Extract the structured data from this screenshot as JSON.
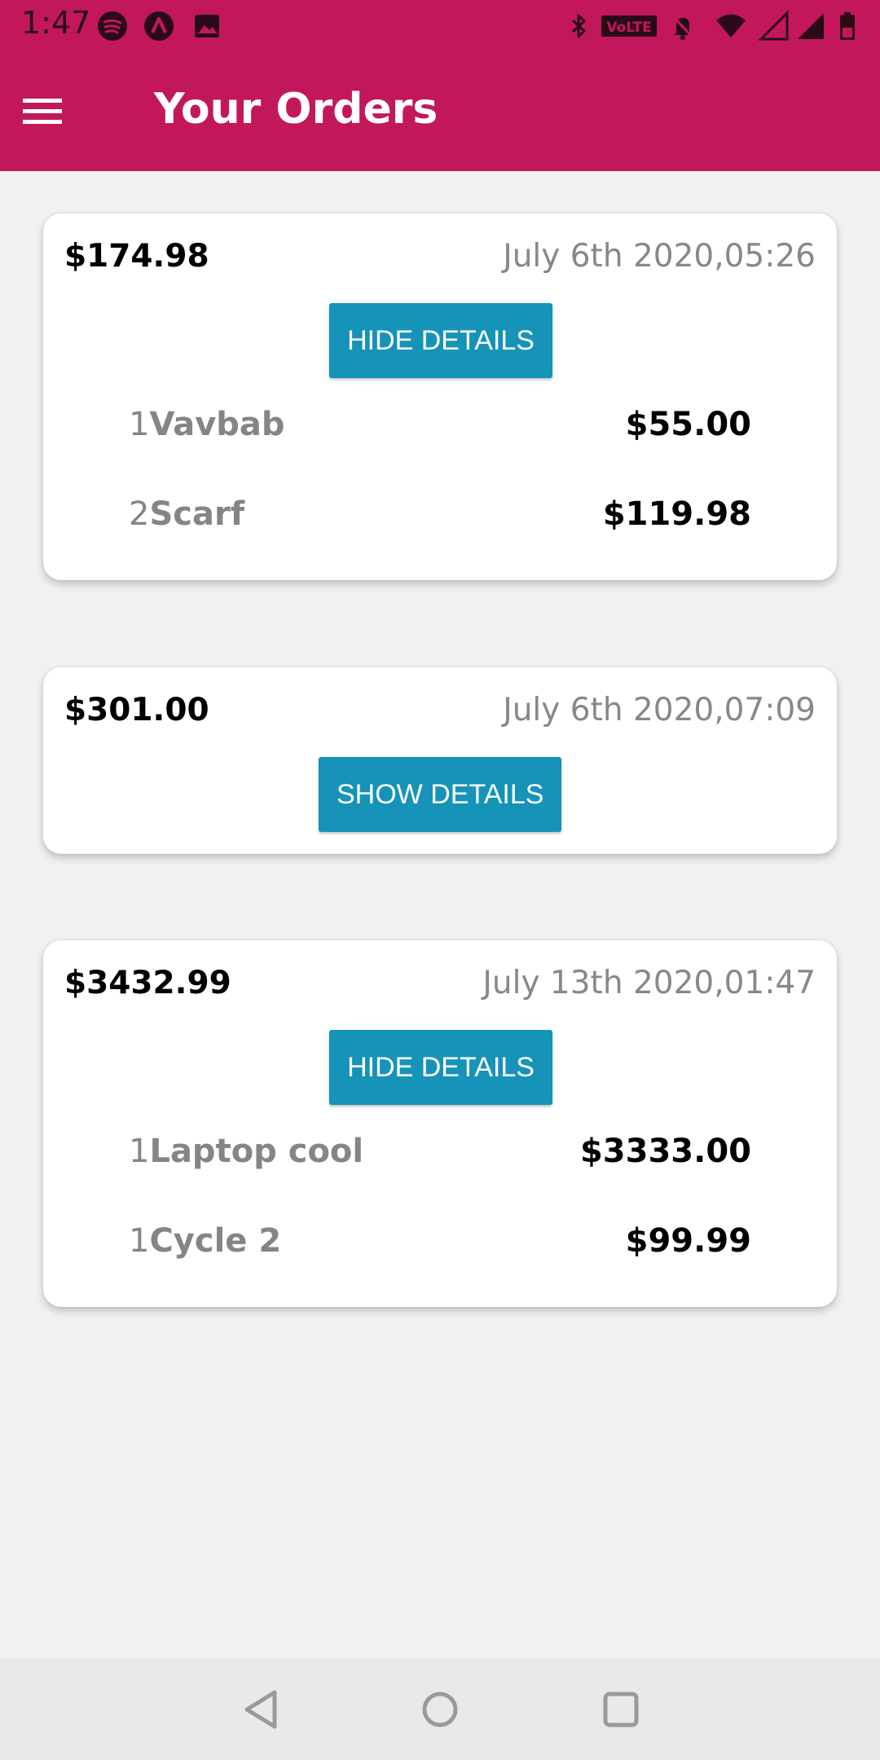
{
  "status_bar": {
    "time": "1:47",
    "left_icons": [
      "spotify-icon",
      "arc-icon",
      "image-icon"
    ],
    "right_icons": [
      "bluetooth-icon",
      "volte-icon",
      "notifications-off-icon",
      "wifi-icon",
      "signal-icon",
      "signal-icon",
      "battery-icon"
    ],
    "volte_label": "VoLTE"
  },
  "app_bar": {
    "menu_icon": "hamburger-menu-icon",
    "title": "Your Orders",
    "color": "#c2185b"
  },
  "orders": [
    {
      "total": "$174.98",
      "date": "July 6th 2020,05:26",
      "button_label": "HIDE DETAILS",
      "items": [
        {
          "qty": "1",
          "name": "Vavbab",
          "price": "$55.00"
        },
        {
          "qty": "2",
          "name": "Scarf",
          "price": "$119.98"
        }
      ]
    },
    {
      "total": "$301.00",
      "date": "July 6th 2020,07:09",
      "button_label": "SHOW DETAILS",
      "items": []
    },
    {
      "total": "$3432.99",
      "date": "July 13th 2020,01:47",
      "button_label": "HIDE DETAILS",
      "items": [
        {
          "qty": "1",
          "name": "Laptop cool",
          "price": "$3333.00"
        },
        {
          "qty": "1",
          "name": "Cycle 2",
          "price": "$99.99"
        }
      ]
    }
  ],
  "button_color": "#1593b8",
  "nav_bar": {
    "icons": [
      "back-icon",
      "home-icon",
      "recents-icon"
    ]
  }
}
